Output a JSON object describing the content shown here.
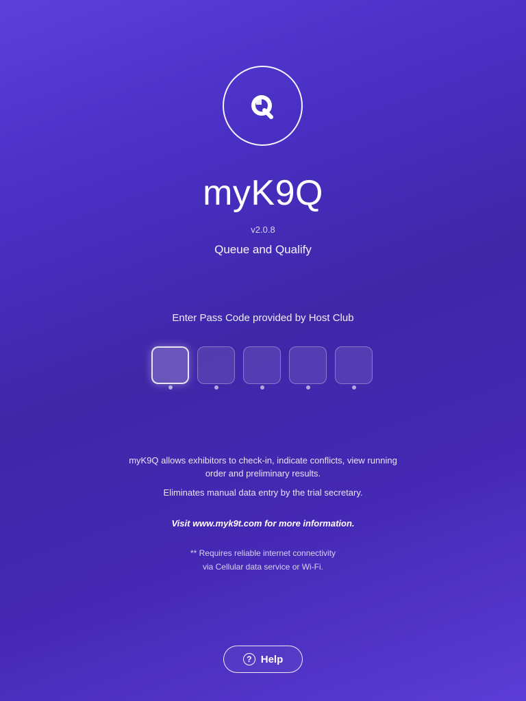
{
  "app": {
    "logo_icon": "myk9q-q-logo-icon",
    "title": "myK9Q",
    "version": "v2.0.8",
    "tagline": "Queue and Qualify"
  },
  "passcode": {
    "prompt": "Enter Pass Code provided by Host Club",
    "slots": [
      "",
      "",
      "",
      "",
      ""
    ],
    "active_index": 0
  },
  "info": {
    "description": "myK9Q allows exhibitors to check-in, indicate conflicts, view running order and preliminary results.",
    "eliminates": "Eliminates manual data entry by the trial secretary.",
    "visit": "Visit www.myk9t.com for more information.",
    "requires_line1": "** Requires reliable internet connectivity",
    "requires_line2": "via Cellular data service or Wi-Fi."
  },
  "help": {
    "icon": "question-circle-icon",
    "icon_glyph": "?",
    "label": "Help"
  },
  "colors": {
    "background_start": "#5b3fd9",
    "background_mid": "#3f27a8",
    "text": "#ffffff"
  }
}
